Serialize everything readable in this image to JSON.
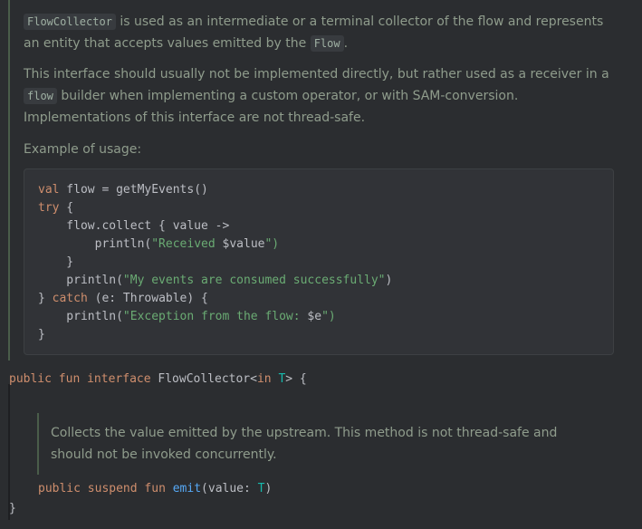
{
  "doc": {
    "p1": {
      "code1": "FlowCollector",
      "text1": " is used as an intermediate or a terminal collector of the flow and represents an entity that accepts values emitted by the ",
      "code2": "Flow",
      "text2": "."
    },
    "p2": {
      "text1": "This interface should usually not be implemented directly, but rather used as a receiver in a ",
      "code1": "flow",
      "text2": " builder when implementing a custom operator, or with SAM-conversion. Implementations of this interface are not thread-safe."
    },
    "p3": "Example of usage:",
    "code": {
      "l1_kw": "val",
      "l1_rest": " flow = getMyEvents()",
      "l2_kw": "try",
      "l2_rest": " {",
      "l3": "    flow.collect { value ->",
      "l4_a": "        println(",
      "l4_s": "\"Received ",
      "l4_v": "$value",
      "l4_e": "\")",
      "l5": "    }",
      "l6_a": "    println(",
      "l6_s": "\"My events are consumed successfully\"",
      "l6_e": ")",
      "l7_a": "} ",
      "l7_kw": "catch",
      "l7_rest": " (e: Throwable) {",
      "l8_a": "    println(",
      "l8_s": "\"Exception from the flow: ",
      "l8_v": "$e",
      "l8_e": "\")",
      "l9": "}"
    }
  },
  "declaration": {
    "kw1": "public",
    "kw2": "fun",
    "kw3": "interface",
    "name": "FlowCollector<",
    "kw_in": "in",
    "type_param": "T",
    "close": "> {"
  },
  "method_doc": "Collects the value emitted by the upstream. This method is not thread-safe and should not be invoked concurrently.",
  "method": {
    "kw1": "public",
    "kw2": "suspend",
    "kw3": "fun",
    "name": "emit",
    "open": "(value: ",
    "type": "T",
    "close": ")"
  },
  "closing_brace": "}"
}
